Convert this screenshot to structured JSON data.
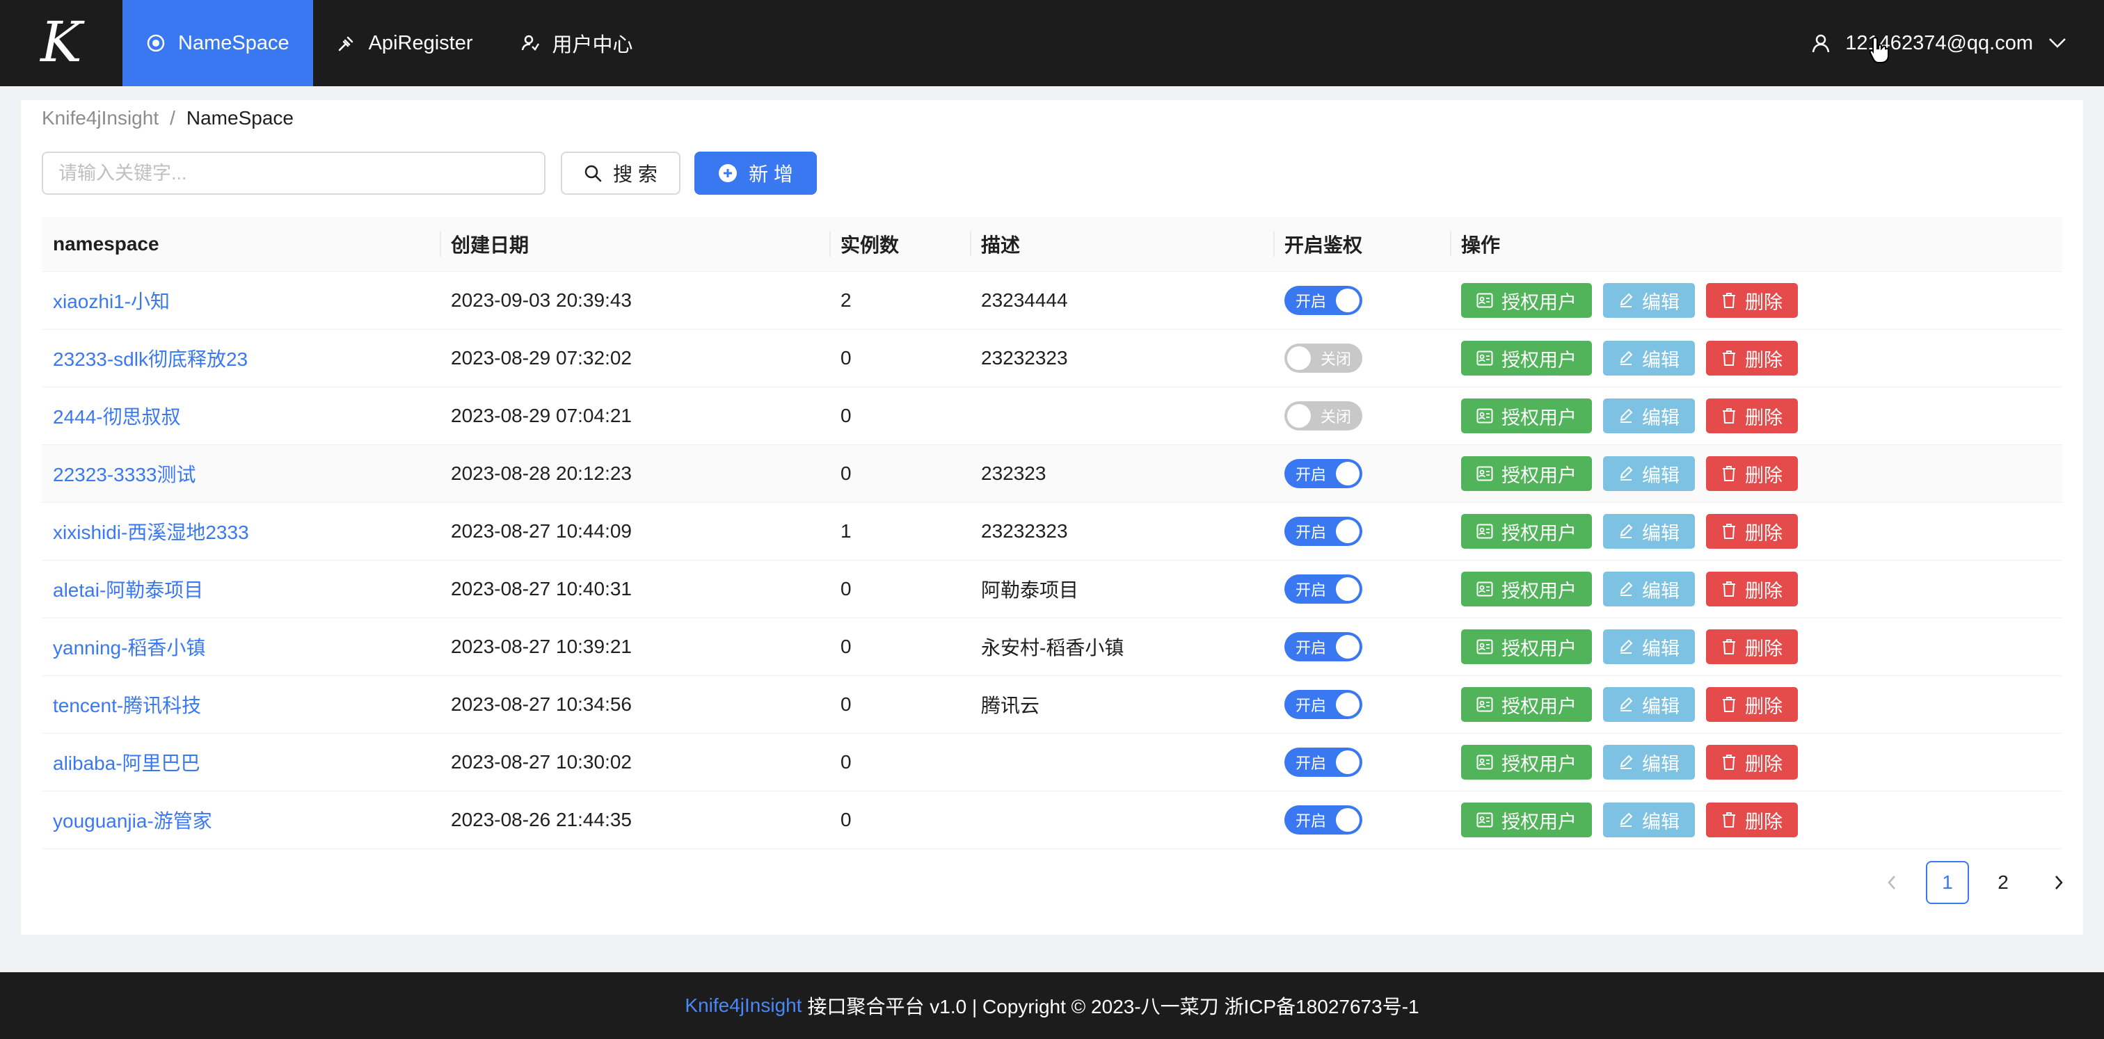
{
  "header": {
    "logo_letter": "K",
    "nav": [
      {
        "label": "NameSpace",
        "icon": "namespace-icon",
        "active": true
      },
      {
        "label": "ApiRegister",
        "icon": "api-register-icon",
        "active": false
      },
      {
        "label": "用户中心",
        "icon": "user-center-icon",
        "active": false
      }
    ],
    "user_email": "121462374@qq.com"
  },
  "breadcrumb": {
    "root": "Knife4jInsight",
    "separator": "/",
    "current": "NameSpace"
  },
  "toolbar": {
    "search_placeholder": "请输入关键字...",
    "search_label": "搜 索",
    "add_label": "新 增"
  },
  "table": {
    "columns": [
      "namespace",
      "创建日期",
      "实例数",
      "描述",
      "开启鉴权",
      "操作"
    ],
    "switch_on_label": "开启",
    "switch_off_label": "关闭",
    "actions": {
      "auth": "授权用户",
      "edit": "编辑",
      "delete": "删除"
    },
    "rows": [
      {
        "namespace": "xiaozhi1-小知",
        "created": "2023-09-03 20:39:43",
        "instances": "2",
        "desc": "23234444",
        "auth_on": true
      },
      {
        "namespace": "23233-sdlk彻底释放23",
        "created": "2023-08-29 07:32:02",
        "instances": "0",
        "desc": "23232323",
        "auth_on": false
      },
      {
        "namespace": "2444-彻思叔叔",
        "created": "2023-08-29 07:04:21",
        "instances": "0",
        "desc": "",
        "auth_on": false
      },
      {
        "namespace": "22323-3333测试",
        "created": "2023-08-28 20:12:23",
        "instances": "0",
        "desc": "232323",
        "auth_on": true,
        "highlight": true
      },
      {
        "namespace": "xixishidi-西溪湿地2333",
        "created": "2023-08-27 10:44:09",
        "instances": "1",
        "desc": "23232323",
        "auth_on": true
      },
      {
        "namespace": "aletai-阿勒泰项目",
        "created": "2023-08-27 10:40:31",
        "instances": "0",
        "desc": "阿勒泰项目",
        "auth_on": true
      },
      {
        "namespace": "yanning-稻香小镇",
        "created": "2023-08-27 10:39:21",
        "instances": "0",
        "desc": "永安村-稻香小镇",
        "auth_on": true
      },
      {
        "namespace": "tencent-腾讯科技",
        "created": "2023-08-27 10:34:56",
        "instances": "0",
        "desc": "腾讯云",
        "auth_on": true
      },
      {
        "namespace": "alibaba-阿里巴巴",
        "created": "2023-08-27 10:30:02",
        "instances": "0",
        "desc": "",
        "auth_on": true
      },
      {
        "namespace": "youguanjia-游管家",
        "created": "2023-08-26 21:44:35",
        "instances": "0",
        "desc": "",
        "auth_on": true
      }
    ]
  },
  "pagination": {
    "pages": [
      "1",
      "2"
    ],
    "current": "1"
  },
  "footer": {
    "brand": "Knife4jInsight",
    "text": "接口聚合平台 v1.0 | Copyright © 2023-八一菜刀 浙ICP备18027673号-1"
  },
  "colors": {
    "accent": "#3a78f2",
    "auth_button": "#52b45a",
    "edit_button": "#7ec2e3",
    "delete_button": "#e54b4b",
    "header_bg": "#1c1c1c"
  }
}
